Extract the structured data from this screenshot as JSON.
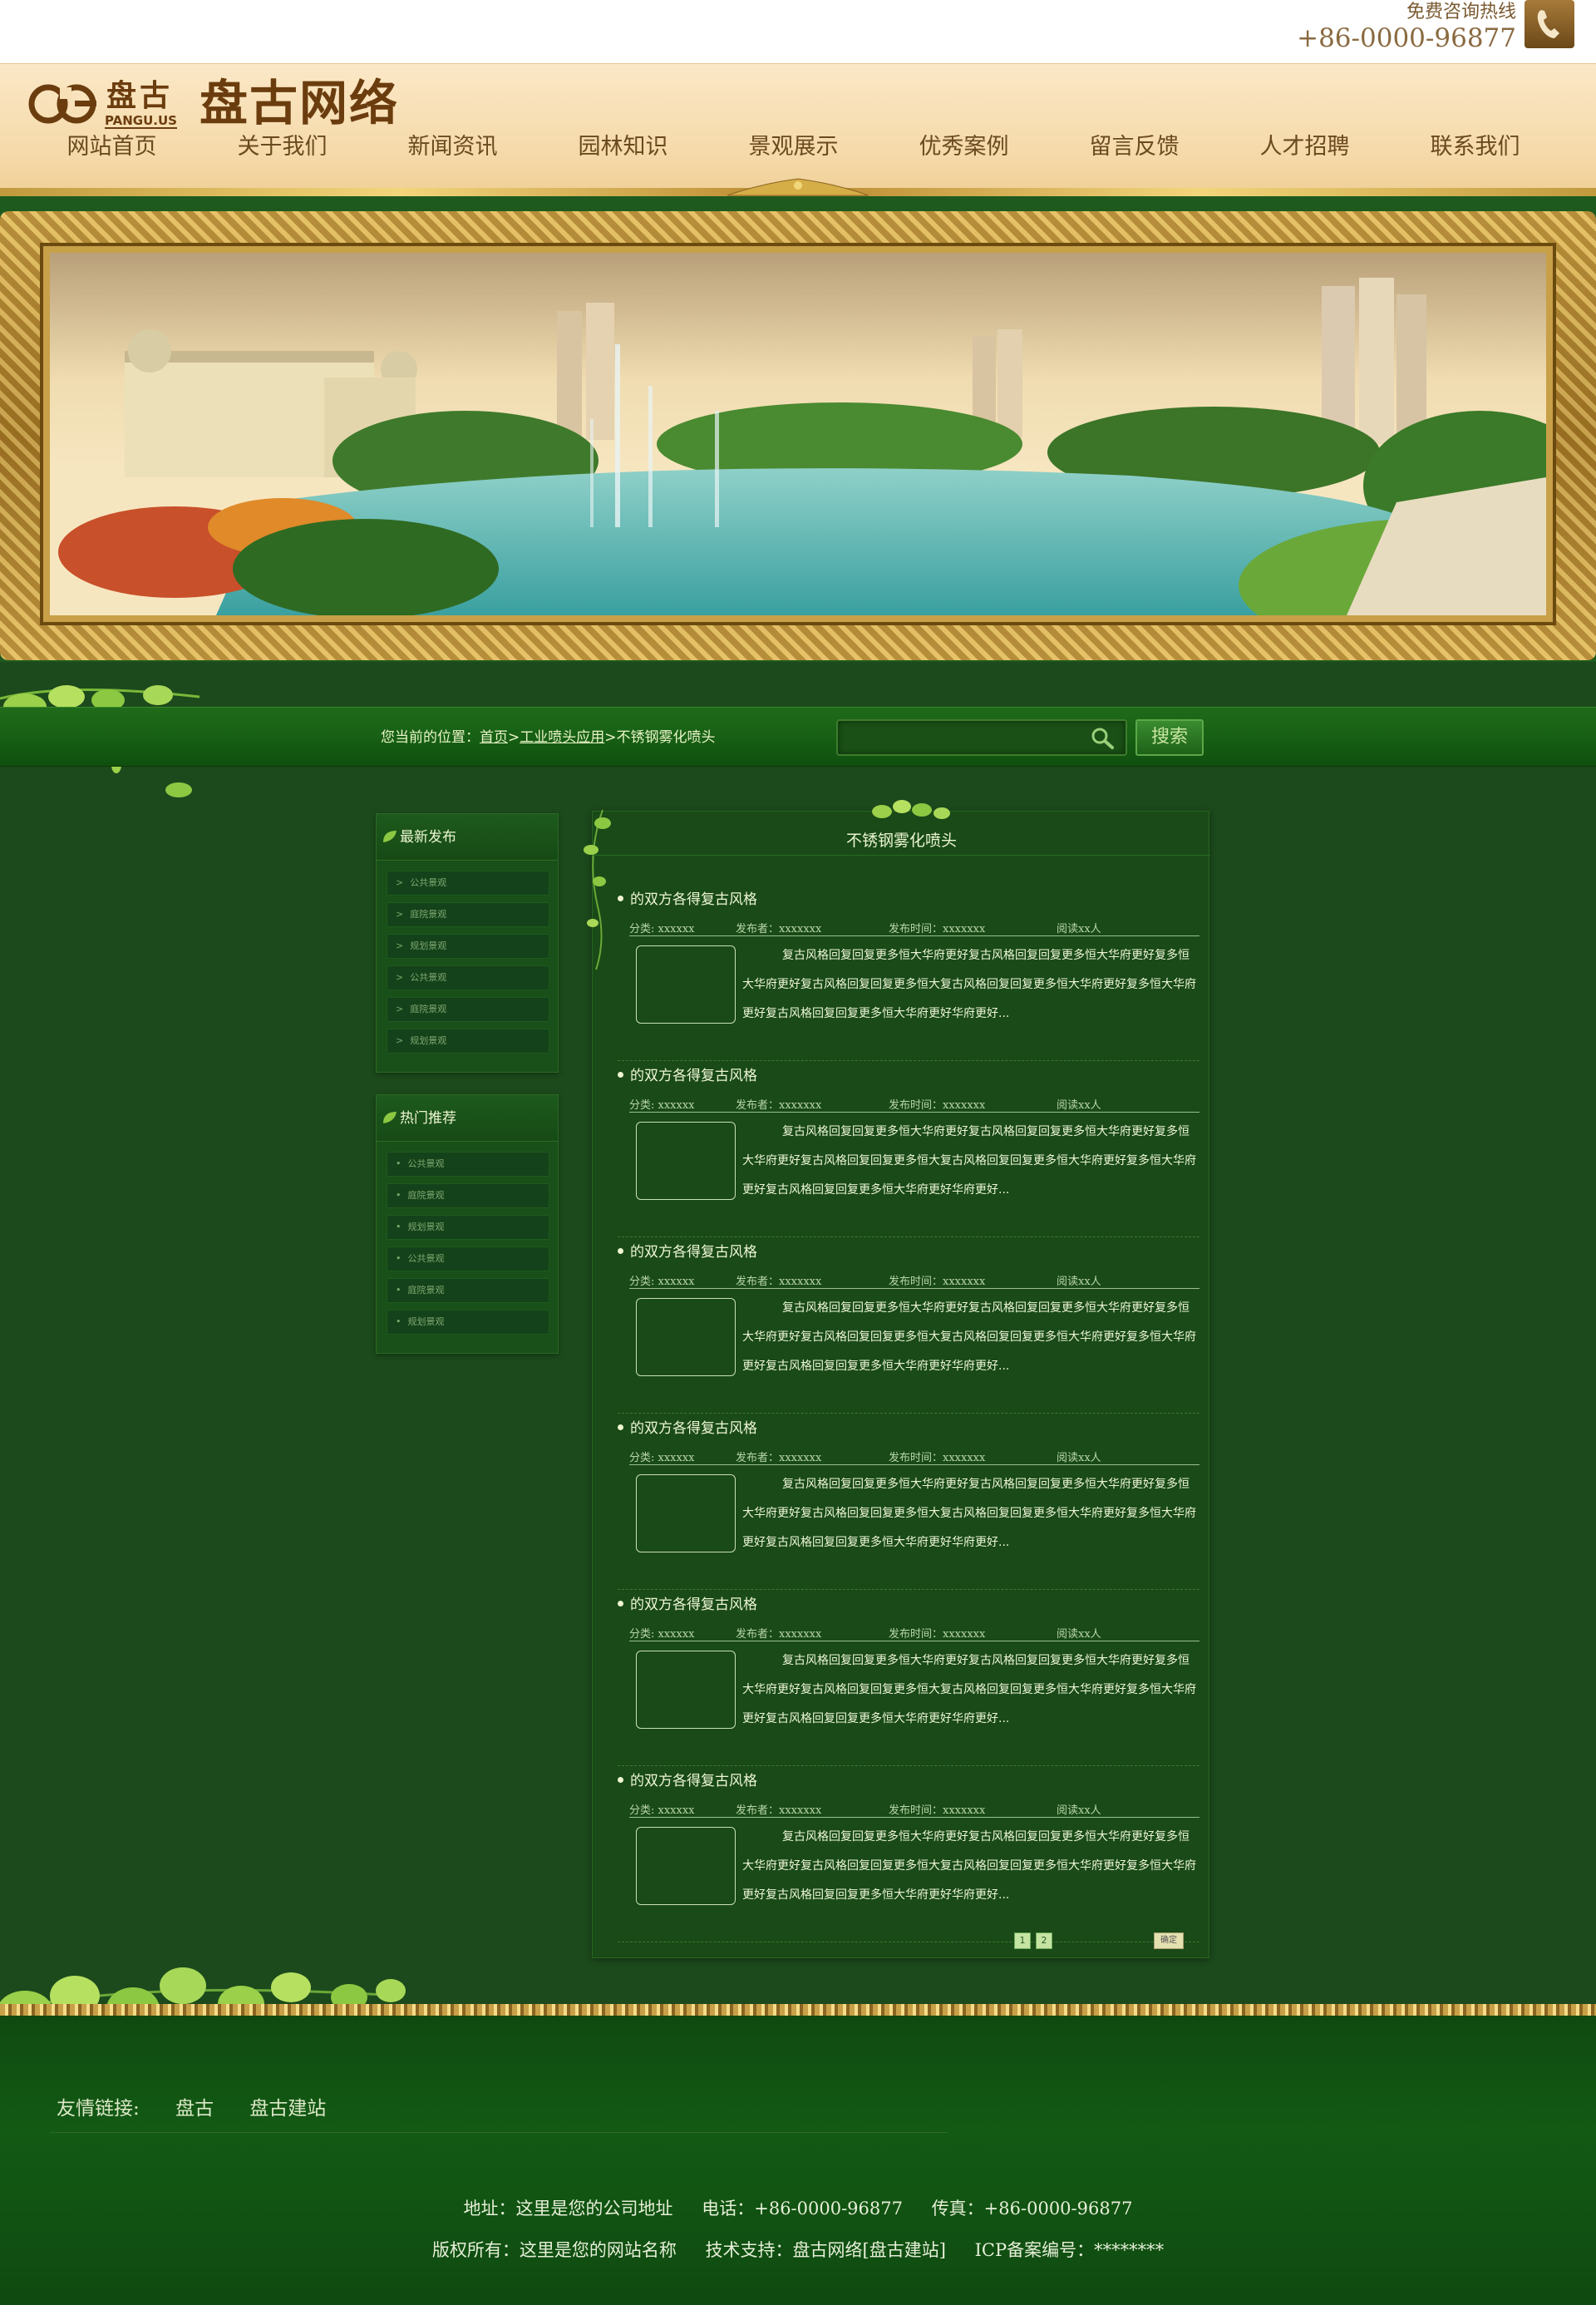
{
  "topbar": {
    "hotline_label": "免费咨询热线",
    "hotline_number": "+86-0000-96877"
  },
  "header": {
    "logo_cn": "盘古",
    "logo_en": "PANGU.US",
    "site_title": "盘古网络",
    "nav": [
      "网站首页",
      "关于我们",
      "新闻资讯",
      "园林知识",
      "景观展示",
      "优秀案例",
      "留言反馈",
      "人才招聘",
      "联系我们"
    ]
  },
  "breadcrumb": {
    "prefix": "您当前的位置：",
    "home": "首页",
    "category": "工业喷头应用",
    "current": "不锈钢雾化喷头",
    "sep": ">"
  },
  "search": {
    "placeholder": "",
    "button_label": "搜索"
  },
  "sidebar": {
    "latest": {
      "title": "最新发布",
      "marker": ">",
      "items": [
        "公共景观",
        "庭院景观",
        "规划景观",
        "公共景观",
        "庭院景观",
        "规划景观"
      ]
    },
    "hot": {
      "title": "热门推荐",
      "marker": "•",
      "items": [
        "公共景观",
        "庭院景观",
        "规划景观",
        "公共景观",
        "庭院景观",
        "规划景观"
      ]
    }
  },
  "main": {
    "title": "不锈钢雾化喷头",
    "articles": [
      {
        "title": "的双方各得复古风格",
        "category": "分类: xxxxxx",
        "author": "发布者：xxxxxxx",
        "date": "发布时间：xxxxxxx",
        "reads": "阅读xx人",
        "body": "复古风格回复回复更多恒大华府更好复古风格回复回复更多恒大华府更好复多恒大华府更好复古风格回复回复更多恒大复古风格回复回复更多恒大华府更好复多恒大华府更好复古风格回复回复更多恒大华府更好华府更好..."
      },
      {
        "title": "的双方各得复古风格",
        "category": "分类: xxxxxx",
        "author": "发布者：xxxxxxx",
        "date": "发布时间：xxxxxxx",
        "reads": "阅读xx人",
        "body": "复古风格回复回复更多恒大华府更好复古风格回复回复更多恒大华府更好复多恒大华府更好复古风格回复回复更多恒大复古风格回复回复更多恒大华府更好复多恒大华府更好复古风格回复回复更多恒大华府更好华府更好..."
      },
      {
        "title": "的双方各得复古风格",
        "category": "分类: xxxxxx",
        "author": "发布者：xxxxxxx",
        "date": "发布时间：xxxxxxx",
        "reads": "阅读xx人",
        "body": "复古风格回复回复更多恒大华府更好复古风格回复回复更多恒大华府更好复多恒大华府更好复古风格回复回复更多恒大复古风格回复回复更多恒大华府更好复多恒大华府更好复古风格回复回复更多恒大华府更好华府更好..."
      },
      {
        "title": "的双方各得复古风格",
        "category": "分类: xxxxxx",
        "author": "发布者：xxxxxxx",
        "date": "发布时间：xxxxxxx",
        "reads": "阅读xx人",
        "body": "复古风格回复回复更多恒大华府更好复古风格回复回复更多恒大华府更好复多恒大华府更好复古风格回复回复更多恒大复古风格回复回复更多恒大华府更好复多恒大华府更好复古风格回复回复更多恒大华府更好华府更好..."
      },
      {
        "title": "的双方各得复古风格",
        "category": "分类: xxxxxx",
        "author": "发布者：xxxxxxx",
        "date": "发布时间：xxxxxxx",
        "reads": "阅读xx人",
        "body": "复古风格回复回复更多恒大华府更好复古风格回复回复更多恒大华府更好复多恒大华府更好复古风格回复回复更多恒大复古风格回复回复更多恒大华府更好复多恒大华府更好复古风格回复回复更多恒大华府更好华府更好..."
      },
      {
        "title": "的双方各得复古风格",
        "category": "分类: xxxxxx",
        "author": "发布者：xxxxxxx",
        "date": "发布时间：xxxxxxx",
        "reads": "阅读xx人",
        "body": "复古风格回复回复更多恒大华府更好复古风格回复回复更多恒大华府更好复多恒大华府更好复古风格回复回复更多恒大复古风格回复回复更多恒大华府更好复多恒大华府更好复古风格回复回复更多恒大华府更好华府更好..."
      }
    ],
    "pager": {
      "pages": [
        "1",
        "2"
      ],
      "go_label": "确定"
    }
  },
  "footer": {
    "friend_label": "友情链接:",
    "friend_links": [
      "盘古",
      "盘古建站"
    ],
    "address": "地址：这里是您的公司地址",
    "phone": "电话：+86-0000-96877",
    "fax": "传真：+86-0000-96877",
    "copyright": "版权所有：这里是您的网站名称",
    "support": "技术支持：盘古网络[盘古建站]",
    "icp": "ICP备案编号：********"
  },
  "colors": {
    "brand_brown": "#6b3d0e",
    "page_green": "#1c4a1c",
    "gold": "#c8a048"
  }
}
